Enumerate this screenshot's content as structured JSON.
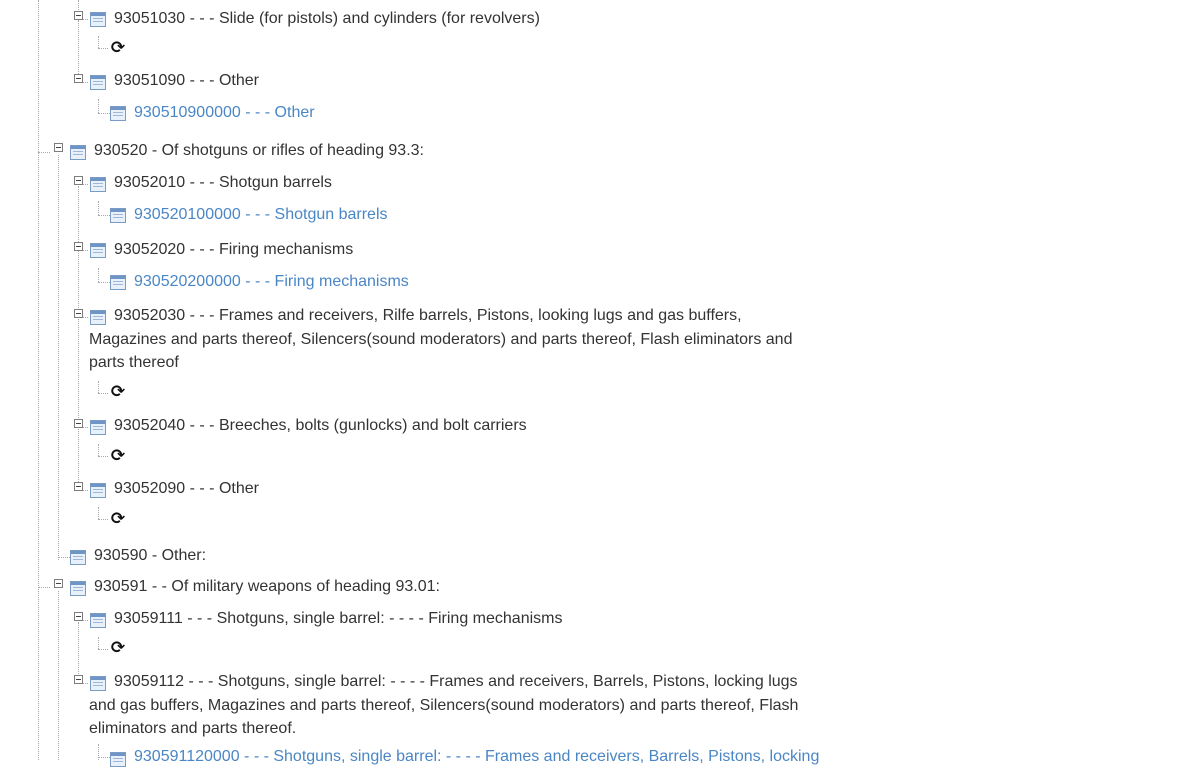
{
  "tree": {
    "refresh_icon": "refresh-icon",
    "node_icon": "grid-document-icon",
    "link_color": "#4a86c5",
    "nodes": [
      {
        "text": "93051030 - - - Slide (for pistols) and cylinders (for revolvers)"
      },
      {
        "text": "93051090 - - - Other"
      },
      {
        "text": "930510900000 - - - Other"
      },
      {
        "text": "930520 - Of shotguns or rifles of heading 93.3:"
      },
      {
        "text": "93052010 - - - Shotgun barrels"
      },
      {
        "text": "930520100000 - - - Shotgun barrels"
      },
      {
        "text": "93052020 - - - Firing mechanisms"
      },
      {
        "text": "930520200000 - - - Firing mechanisms"
      },
      {
        "line1": "93052030 - - - Frames and receivers, Rilfe barrels, Pistons, looking lugs and gas buffers,",
        "rest": "Magazines and parts thereof, Silencers(sound moderators) and parts thereof, Flash eliminators and parts thereof"
      },
      {
        "text": "93052040 - - - Breeches, bolts (gunlocks) and bolt carriers"
      },
      {
        "text": "93052090 - - - Other"
      },
      {
        "text": "930590 - Other:"
      },
      {
        "text": "930591 - - Of military weapons of heading 93.01:"
      },
      {
        "text": "93059111 - - - Shotguns, single barrel: - - - - Firing mechanisms"
      },
      {
        "line1": "93059112 - - - Shotguns, single barrel: - - - - Frames and receivers, Barrels, Pistons, locking lugs",
        "rest": "and gas buffers, Magazines and parts thereof, Silencers(sound moderators) and parts thereof, Flash eliminators and parts thereof."
      },
      {
        "text": "930591120000 - - - Shotguns, single barrel: - - - - Frames and receivers, Barrels, Pistons, locking"
      }
    ]
  }
}
